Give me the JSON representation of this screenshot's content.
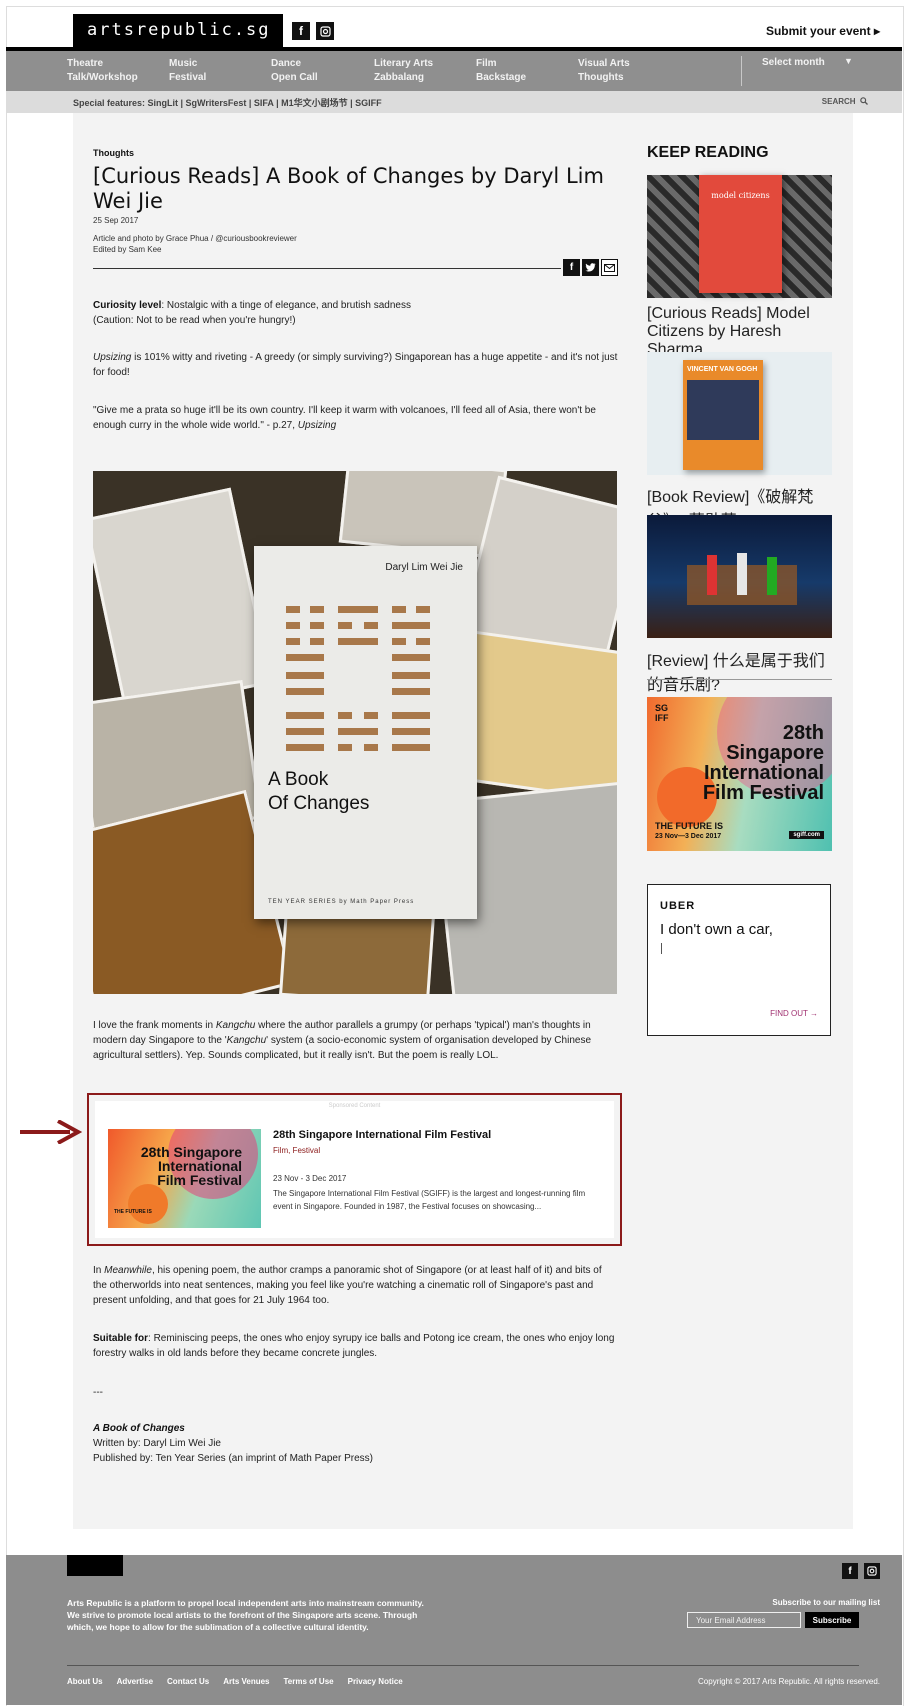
{
  "header": {
    "logo": "artsrepublic.sg",
    "submit": "Submit your event ▸"
  },
  "nav": {
    "columns": [
      [
        "Theatre",
        "Talk/Workshop"
      ],
      [
        "Music",
        "Festival"
      ],
      [
        "Dance",
        "Open Call"
      ],
      [
        "Literary Arts",
        "Zabbalang"
      ],
      [
        "Film",
        "Backstage"
      ],
      [
        "Visual Arts",
        "Thoughts"
      ]
    ],
    "select_month": "Select month"
  },
  "special": {
    "text": "Special features: SingLit | SgWritersFest | SIFA | M1华文小剧场节 | SGIFF",
    "search": "SEARCH"
  },
  "article": {
    "category": "Thoughts",
    "title": "[Curious Reads] A Book of Changes by Daryl Lim Wei Jie",
    "date": "25 Sep 2017",
    "credit": "Article and photo by Grace Phua / @curiousbookreviewer",
    "editor": "Edited by Sam Kee",
    "curiosity_label": "Curiosity level",
    "curiosity_text": ": Nostalgic with a tinge of elegance, and brutish sadness",
    "caution": "(Caution: Not to be read when you're hungry!)",
    "p2_em": "Upsizing",
    "p2": " is 101% witty and riveting - A greedy (or simply surviving?) Singaporean has a huge appetite - and it's not just for food!",
    "p3": "\"Give me a prata so huge it'll be its own country. I'll keep it warm with volcanoes, I'll feed all of Asia, there won't be enough curry in the whole wide world.\" - p.27, ",
    "p3_em": "Upsizing",
    "book_author": "Daryl Lim Wei Jie",
    "book_title_1": "A Book",
    "book_title_2": "Of Changes",
    "book_series": "TEN YEAR SERIES by Math Paper Press",
    "p4_a": "I love the frank moments in ",
    "p4_em1": "Kangchu",
    "p4_b": " where the author parallels a grumpy (or perhaps 'typical') man's thoughts in modern day Singapore to the '",
    "p4_em2": "Kangchu",
    "p4_c": "' system (a socio-economic system of organisation developed by Chinese agricultural settlers). Yep. Sounds complicated, but it really isn't. But the poem is really LOL.",
    "p5_a": "In ",
    "p5_em": "Meanwhile",
    "p5_b": ", his opening poem, the author cramps a panoramic shot of Singapore (or at least half of it) and bits of the otherworlds into neat sentences, making you feel like you're watching a cinematic roll of Singapore's past and present unfolding, and that goes for 21 July 1964 too.",
    "suitable_label": "Suitable for",
    "suitable_text": ": Reminiscing peeps, the ones who enjoy syrupy ice balls and Potong ice cream, the ones who enjoy long forestry walks in old lands before they became concrete jungles.",
    "divider": "---",
    "info_title": "A Book of Changes",
    "written_by": "Written by: Daryl Lim Wei Jie",
    "published_by": "Published by: Ten Year Series (an imprint of Math Paper Press)"
  },
  "sponsored": {
    "label": "Sponsored Content",
    "title": "28th Singapore International Film Festival",
    "category": "Film, Festival",
    "date": "23 Nov - 3 Dec 2017",
    "desc": "The Singapore International Film Festival (SGIFF) is the largest and longest-running film event in Singapore. Founded in 1987, the Festival focuses on showcasing...",
    "thumb_text": "28th Singapore International Film Festival",
    "thumb_sub": "THE FUTURE IS"
  },
  "sidebar": {
    "heading": "KEEP READING",
    "items": [
      {
        "title": "[Curious Reads] Model Citizens by Haresh Sharma",
        "book_text": "model citizens"
      },
      {
        "title": "[Book Review]《破解梵谷》- 蒋勋著",
        "book_text": "VINCENT VAN GOGH"
      },
      {
        "title": "[Review] 什么是属于我们的音乐剧?"
      }
    ]
  },
  "ad_sgiff": {
    "l1": "28th",
    "l2": "Singapore",
    "l3": "International",
    "l4": "Film Festival",
    "future": "THE FUTURE IS",
    "dates": "23 Nov—3 Dec 2017",
    "site": "sgiff.com"
  },
  "uber": {
    "brand": "UBER",
    "headline": "I don't own a car,",
    "cta": "FIND OUT  →"
  },
  "footer": {
    "about": "Arts Republic is a platform to propel local independent arts into mainstream community. We strive to promote local artists to the forefront of the Singapore arts scene. Through which, we hope to allow for the sublimation of a collective cultural identity.",
    "subscribe_label": "Subscribe to our mailing list",
    "email_placeholder": "Your Email Address",
    "subscribe_button": "Subscribe",
    "links": [
      "About Us",
      "Advertise",
      "Contact Us",
      "Arts Venues",
      "Terms of Use",
      "Privacy Notice"
    ],
    "copyright": "Copyright © 2017 Arts Republic. All rights reserved."
  },
  "colors": {
    "nav_bg": "#8f8f8f",
    "highlight_border": "#8b1a1a",
    "footer_bg": "#8d8d8d"
  }
}
